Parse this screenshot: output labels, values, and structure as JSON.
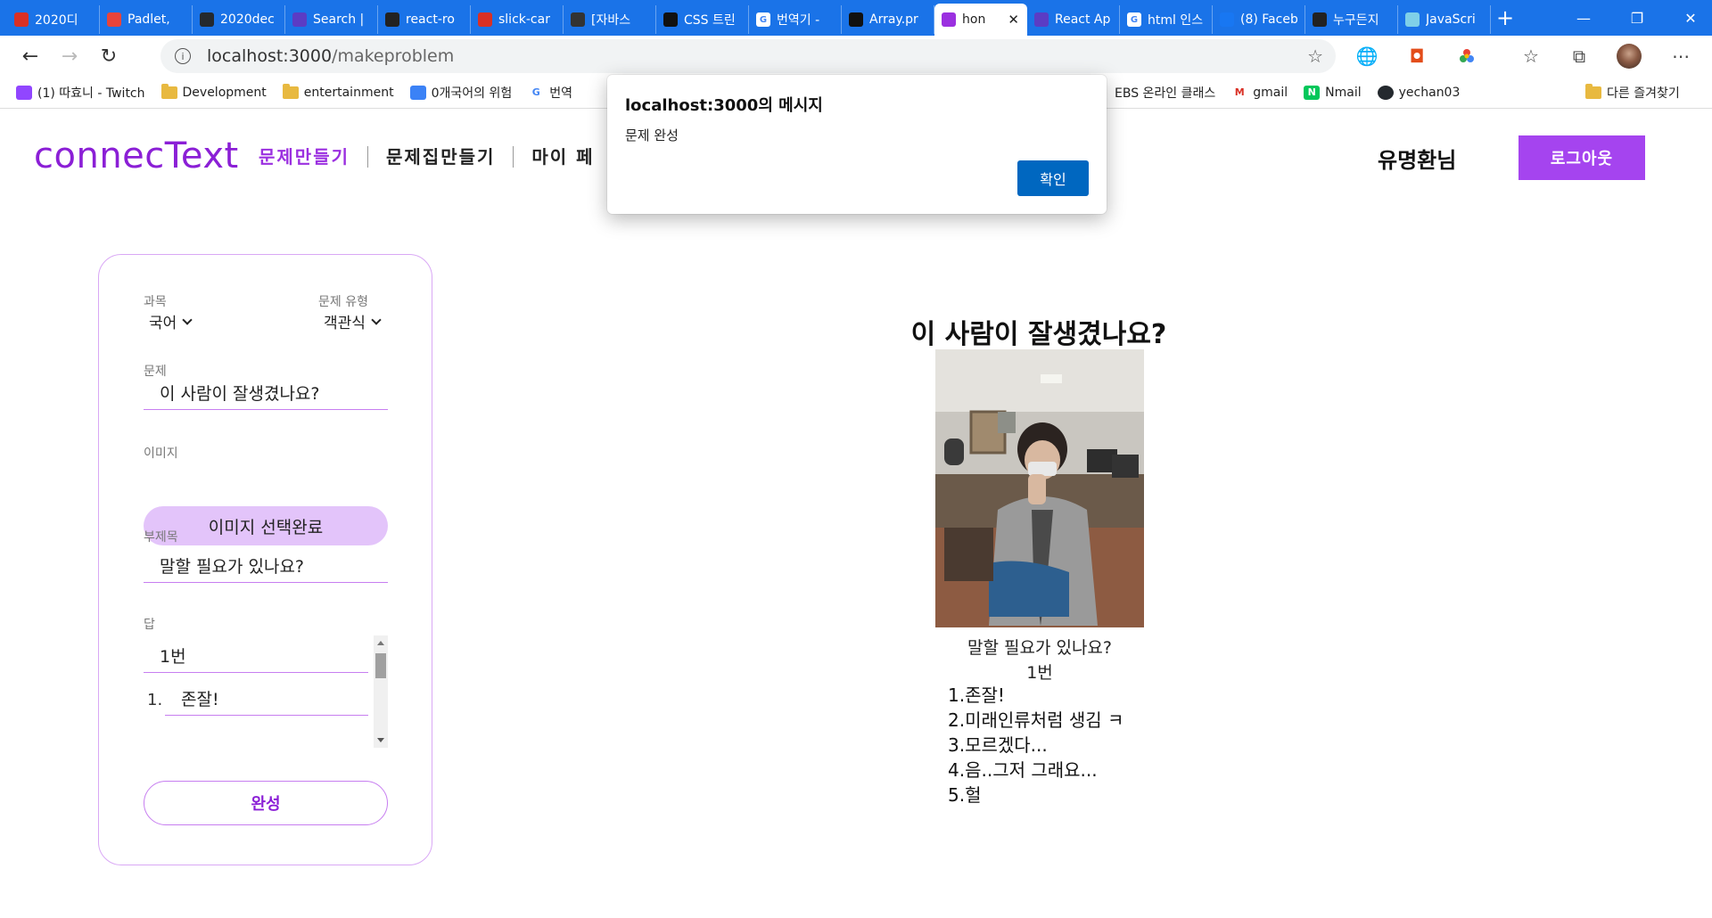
{
  "browser": {
    "tabs": [
      {
        "label": "2020디",
        "favicon": "pdf-icon",
        "color": "#d93025"
      },
      {
        "label": "Padlet, ",
        "favicon": "padlet-icon",
        "color": "#e8443a"
      },
      {
        "label": "2020dec",
        "favicon": "github-icon",
        "color": "#24292e"
      },
      {
        "label": "Search |",
        "favicon": "search-logo-icon",
        "color": "#5b3cc4"
      },
      {
        "label": "react-ro",
        "favicon": "codepen-icon",
        "color": "#222222"
      },
      {
        "label": "slick-car",
        "favicon": "notion-icon",
        "color": "#d93025"
      },
      {
        "label": "[자바스",
        "favicon": "dots-icon",
        "color": "#333333"
      },
      {
        "label": "CSS 트린",
        "favicon": "speech-bubble-icon",
        "color": "#111111"
      },
      {
        "label": "번역기 -",
        "favicon": "google-icon",
        "color": "#ffffff"
      },
      {
        "label": "Array.pr",
        "favicon": "speech-bubble-icon",
        "color": "#111111"
      },
      {
        "label": "hon",
        "favicon": "react-icon",
        "color": "#9b30e0",
        "active": true
      },
      {
        "label": "React Ap",
        "favicon": "react-icon",
        "color": "#5b3cc4"
      },
      {
        "label": "html 인스",
        "favicon": "google-icon",
        "color": "#ffffff"
      },
      {
        "label": "(8) Faceb",
        "favicon": "facebook-icon",
        "color": "#1877f2"
      },
      {
        "label": "누구든지",
        "favicon": "codepen-icon",
        "color": "#222222"
      },
      {
        "label": "JavaScri",
        "favicon": "image-icon",
        "color": "#7fd0e8"
      }
    ],
    "url_host": "localhost:3000",
    "url_path": "/makeproblem",
    "bookmarks": [
      {
        "label": "(1) 따효니 - Twitch",
        "icon": "twitch-icon",
        "color": "#9146ff"
      },
      {
        "label": "Development",
        "icon": "folder-icon"
      },
      {
        "label": "entertainment",
        "icon": "folder-icon"
      },
      {
        "label": "0개국어의 위험",
        "icon": "diamond-icon",
        "color": "#3b82f6"
      },
      {
        "label": "번역",
        "icon": "google-icon"
      }
    ],
    "bookmarks_right": [
      {
        "label": "EBS 온라인 클래스",
        "icon": "none"
      },
      {
        "label": "gmail",
        "icon": "gmail-icon"
      },
      {
        "label": "Nmail",
        "icon": "naver-icon",
        "color": "#03c75a"
      },
      {
        "label": "yechan03",
        "icon": "github-icon"
      }
    ],
    "other_bookmarks": "다른 즐겨찾기"
  },
  "header": {
    "logo": "connecText",
    "menu": [
      "문제만들기",
      "문제집만들기",
      "마이 페"
    ],
    "username": "유명환님",
    "logout": "로그아웃"
  },
  "form": {
    "subject_label": "과목",
    "subject_value": "국어",
    "type_label": "문제 유형",
    "type_value": "객관식",
    "question_label": "문제",
    "question_value": "이 사람이 잘생겼나요?",
    "image_label": "이미지",
    "image_button": "이미지 선택완료",
    "subtitle_label": "부제목",
    "subtitle_value": "말할 필요가 있나요?",
    "answer_label": "답",
    "answer_value": "1번",
    "option_number": "1.",
    "option_value": "존잘!",
    "complete_button": "완성"
  },
  "preview": {
    "title": "이 사람이 잘생겼나요?",
    "subtitle": "말할 필요가 있나요?",
    "answer": "1번",
    "options": [
      "1.존잘!",
      "2.미래인류처럼 생김 ㅋ",
      "3.모르겠다...",
      "4.음..그저 그래요...",
      "5.헐"
    ]
  },
  "dialog": {
    "title": "localhost:3000의 메시지",
    "message": "문제 완성",
    "ok": "확인"
  }
}
